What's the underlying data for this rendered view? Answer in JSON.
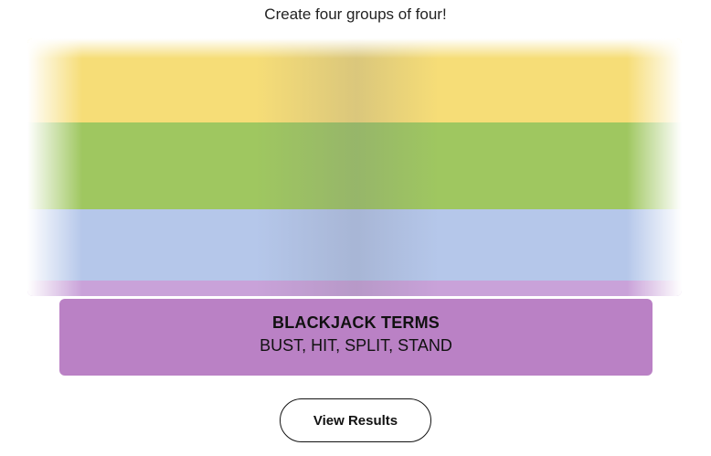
{
  "game": {
    "instructions": "Create four groups of four!"
  },
  "solved_group": {
    "title": "BLACKJACK TERMS",
    "words": "BUST, HIT, SPLIT, STAND",
    "color": "#ba81c5"
  },
  "hidden_board": {
    "row_colors": [
      "#f6dd77",
      "#9fc760",
      "#b5c7ea",
      "#c9a2d9"
    ]
  },
  "actions": {
    "view_results_label": "View Results"
  }
}
